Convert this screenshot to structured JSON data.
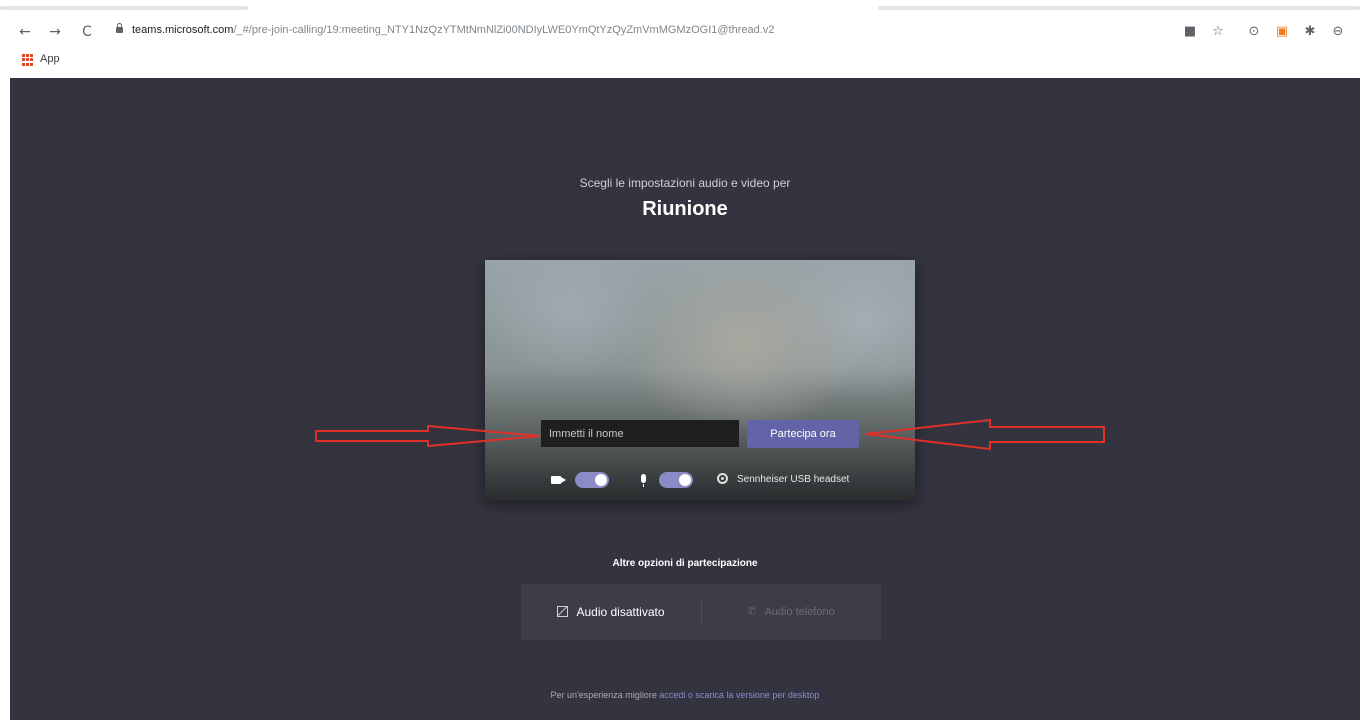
{
  "browser": {
    "url_host": "teams.microsoft.com",
    "url_path": "/_#/pre-join-calling/19:meeting_NTY1NzQzYTMtNmNlZi00NDIyLWE0YmQtYzQyZmVmMGMzOGI1@thread.v2",
    "nav": {
      "back": "←",
      "forward": "→",
      "reload": "C"
    },
    "extensions": [
      "■",
      "☆",
      "⊙",
      "▣",
      "✱",
      "⊖"
    ],
    "bookmarks": {
      "apps_label": "App"
    }
  },
  "meeting": {
    "subtitle": "Scegli le impostazioni audio e video per",
    "title": "Riunione"
  },
  "preview": {
    "name_placeholder": "Immetti il nome",
    "join_label": "Partecipa ora",
    "camera_on": true,
    "mic_on": true,
    "device_label": "Sennheiser USB headset"
  },
  "other_options": {
    "heading": "Altre opzioni di partecipazione",
    "audio_off_label": "Audio disattivato",
    "phone_label": "Audio telefono",
    "phone_icon": "✆"
  },
  "footer": {
    "text": "Per un'esperienza migliore",
    "link": "accedi o scarica la versione per desktop"
  },
  "colors": {
    "background": "#33343f",
    "accent": "#6264a7",
    "annotation": "#e0302a"
  }
}
